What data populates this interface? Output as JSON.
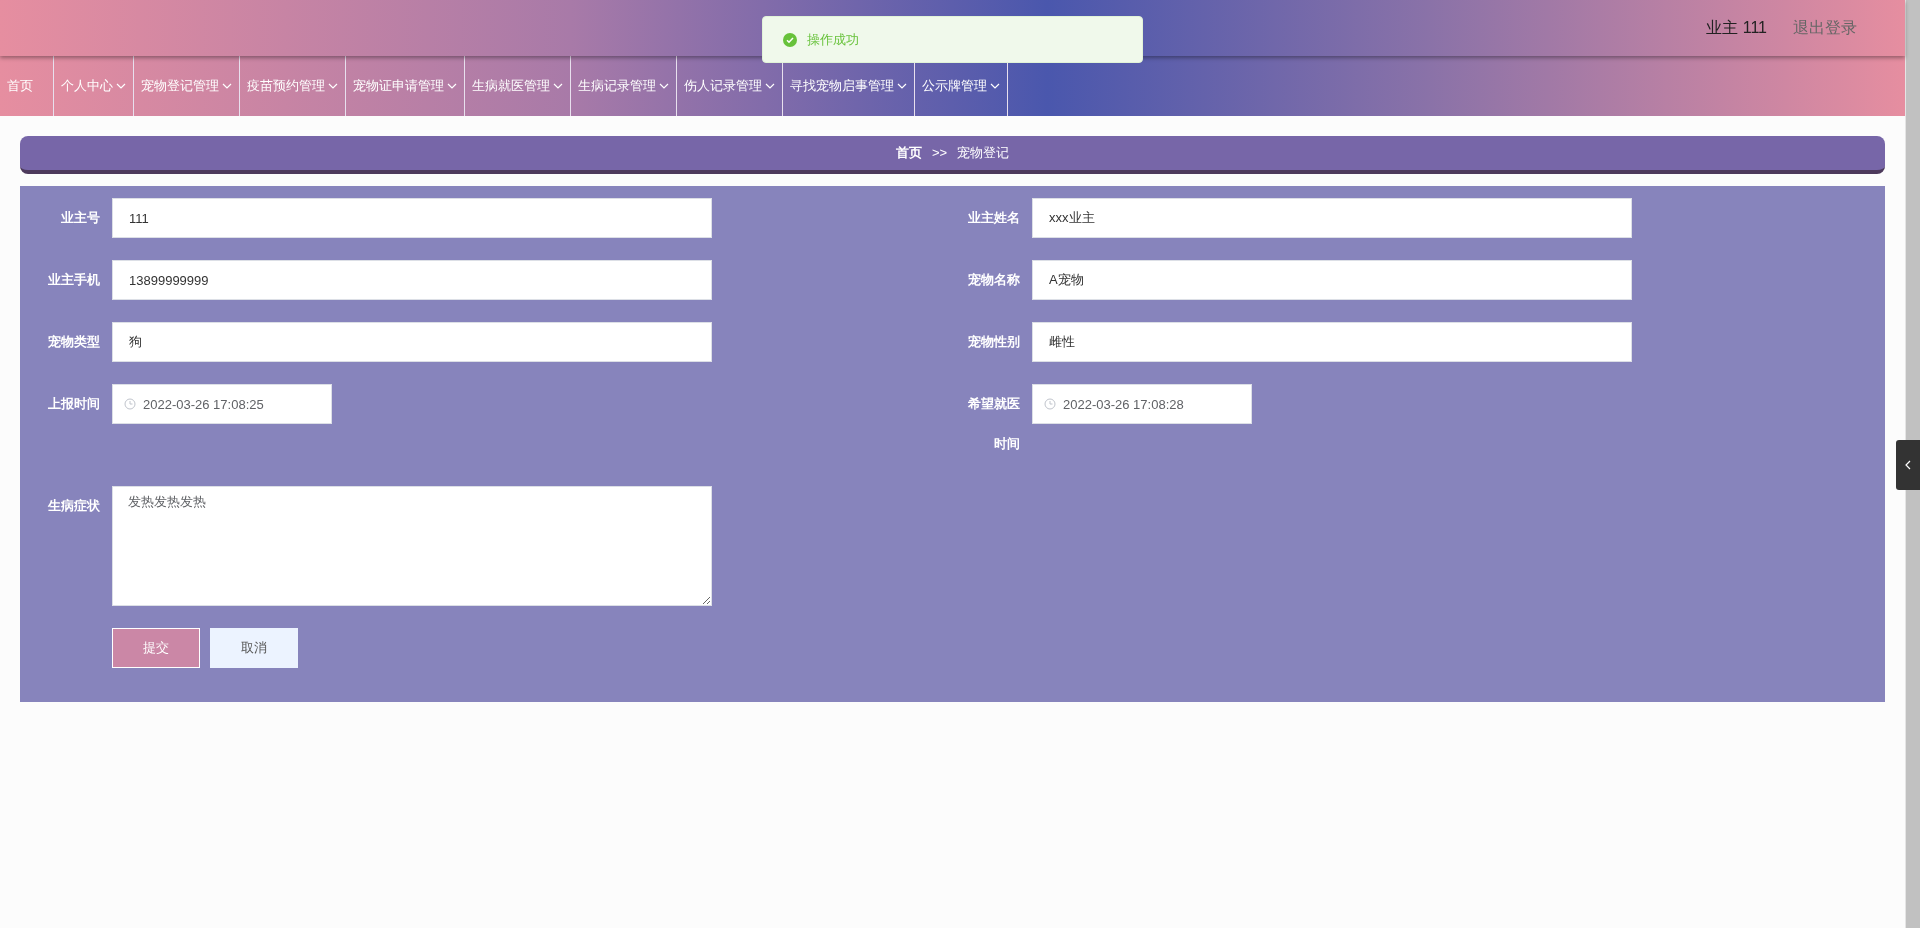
{
  "toast": {
    "kind": "success",
    "text": "操作成功"
  },
  "header": {
    "user": "业主 111",
    "logout": "退出登录"
  },
  "nav": [
    {
      "label": "首页",
      "dropdown": false
    },
    {
      "label": "个人中心",
      "dropdown": true
    },
    {
      "label": "宠物登记管理",
      "dropdown": true
    },
    {
      "label": "疫苗预约管理",
      "dropdown": true
    },
    {
      "label": "宠物证申请管理",
      "dropdown": true
    },
    {
      "label": "生病就医管理",
      "dropdown": true
    },
    {
      "label": "生病记录管理",
      "dropdown": true
    },
    {
      "label": "伤人记录管理",
      "dropdown": true
    },
    {
      "label": "寻找宠物启事管理",
      "dropdown": true
    },
    {
      "label": "公示牌管理",
      "dropdown": true
    }
  ],
  "breadcrumb": {
    "home": "首页",
    "separator": ">>",
    "current": "宠物登记"
  },
  "form": {
    "fields": [
      {
        "label": "业主号",
        "value": "111",
        "kind": "text"
      },
      {
        "label": "业主姓名",
        "value": "xxx业主",
        "kind": "text"
      },
      {
        "label": "业主手机",
        "value": "13899999999",
        "kind": "text"
      },
      {
        "label": "宠物名称",
        "value": "A宠物",
        "kind": "text"
      },
      {
        "label": "宠物类型",
        "value": "狗",
        "kind": "text"
      },
      {
        "label": "宠物性别",
        "value": "雌性",
        "kind": "text"
      },
      {
        "label": "上报时间",
        "value": "2022-03-26 17:08:25",
        "kind": "datetime"
      },
      {
        "label": "希望就医时间",
        "value": "2022-03-26 17:08:28",
        "kind": "datetime"
      },
      {
        "label": "生病症状",
        "value": "发热发热发热",
        "kind": "textarea"
      }
    ],
    "buttons": [
      {
        "label": "提交",
        "kind": "primary"
      },
      {
        "label": "取消",
        "kind": "secondary"
      }
    ]
  }
}
